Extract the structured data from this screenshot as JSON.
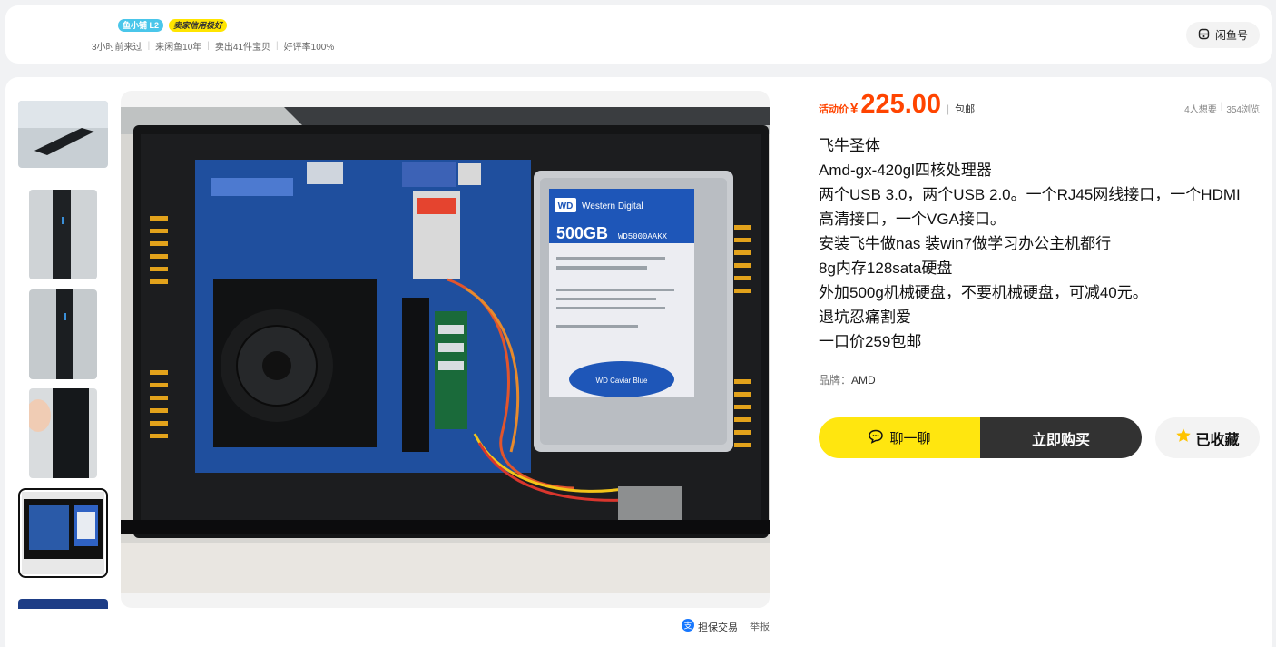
{
  "seller": {
    "badge_level": "鱼小铺 L2",
    "badge_credit": "卖家信用极好",
    "stats": [
      "3小时前来过",
      "来闲鱼10年",
      "卖出41件宝贝",
      "好评率100%"
    ],
    "xianyu_button": "闲鱼号"
  },
  "price": {
    "label": "活动价",
    "currency": "¥",
    "amount": "225.00",
    "shipping": "包邮",
    "wants": "4人想要",
    "views": "354浏览"
  },
  "description": [
    "飞牛圣体",
    "Amd-gx-420gl四核处理器",
    "两个USB 3.0，两个USB 2.0。一个RJ45网线接口，一个HDMI",
    "高清接口，一个VGA接口。",
    "安装飞牛做nas 装win7做学习办公主机都行",
    "8g内存128sata硬盘",
    "外加500g机械硬盘，不要机械硬盘，可减40元。",
    "退坑忍痛割爱",
    "一口价259包邮"
  ],
  "brand": {
    "label": "品牌：",
    "value": "AMD"
  },
  "actions": {
    "chat": "聊一聊",
    "buy": "立即购买",
    "favorite": "已收藏"
  },
  "footer": {
    "guarantee": "担保交易",
    "report": "举报"
  },
  "photo_text": {
    "hdd_brand": "WD",
    "hdd_brand_name": "Western Digital",
    "hdd_capacity": "500GB",
    "hdd_model": "WD5000AAKX",
    "hdd_series": "WD Caviar Blue"
  },
  "colors": {
    "accent": "#ff4400",
    "yellow": "#ffe60f",
    "dark": "#323232"
  }
}
